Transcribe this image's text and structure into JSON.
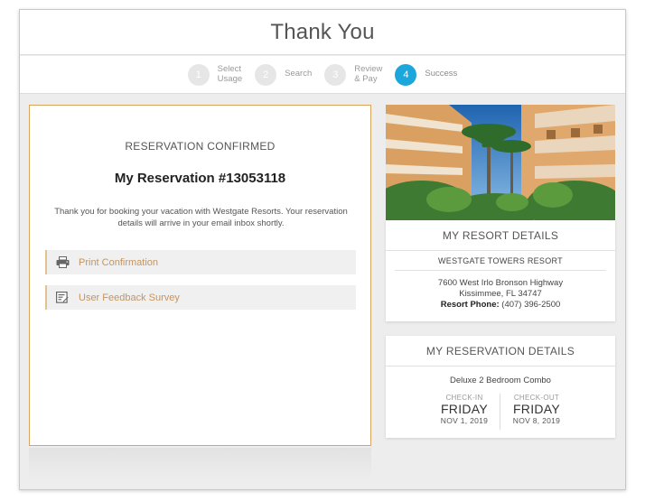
{
  "header": {
    "title": "Thank You"
  },
  "steps": [
    {
      "number": "1",
      "label": "Select\nUsage",
      "active": false
    },
    {
      "number": "2",
      "label": "Search",
      "active": false
    },
    {
      "number": "3",
      "label": "Review\n& Pay",
      "active": false
    },
    {
      "number": "4",
      "label": "Success",
      "active": true
    }
  ],
  "confirmation": {
    "heading": "RESERVATION CONFIRMED",
    "reservation_title": "My Reservation #13053118",
    "message": "Thank you for booking your vacation with Westgate Resorts. Your reservation details will arrive in your email inbox shortly.",
    "actions": [
      {
        "label": "Print Confirmation",
        "icon": "printer-icon"
      },
      {
        "label": "User Feedback Survey",
        "icon": "survey-icon"
      }
    ]
  },
  "resort": {
    "heading": "MY RESORT DETAILS",
    "name": "WESTGATE TOWERS RESORT",
    "address_line1": "7600 West Irlo Bronson Highway",
    "address_line2": "Kissimmee, FL 34747",
    "phone_label": "Resort Phone:",
    "phone": "(407) 396-2500"
  },
  "reservation": {
    "heading": "MY RESERVATION DETAILS",
    "room_type": "Deluxe 2 Bedroom Combo",
    "check_in": {
      "label": "CHECK-IN",
      "day": "FRIDAY",
      "date": "NOV 1, 2019"
    },
    "check_out": {
      "label": "CHECK-OUT",
      "day": "FRIDAY",
      "date": "NOV 8, 2019"
    }
  },
  "colors": {
    "accent": "#1ba6dc",
    "card_border": "#d9a45c",
    "action_text": "#c8935a"
  }
}
